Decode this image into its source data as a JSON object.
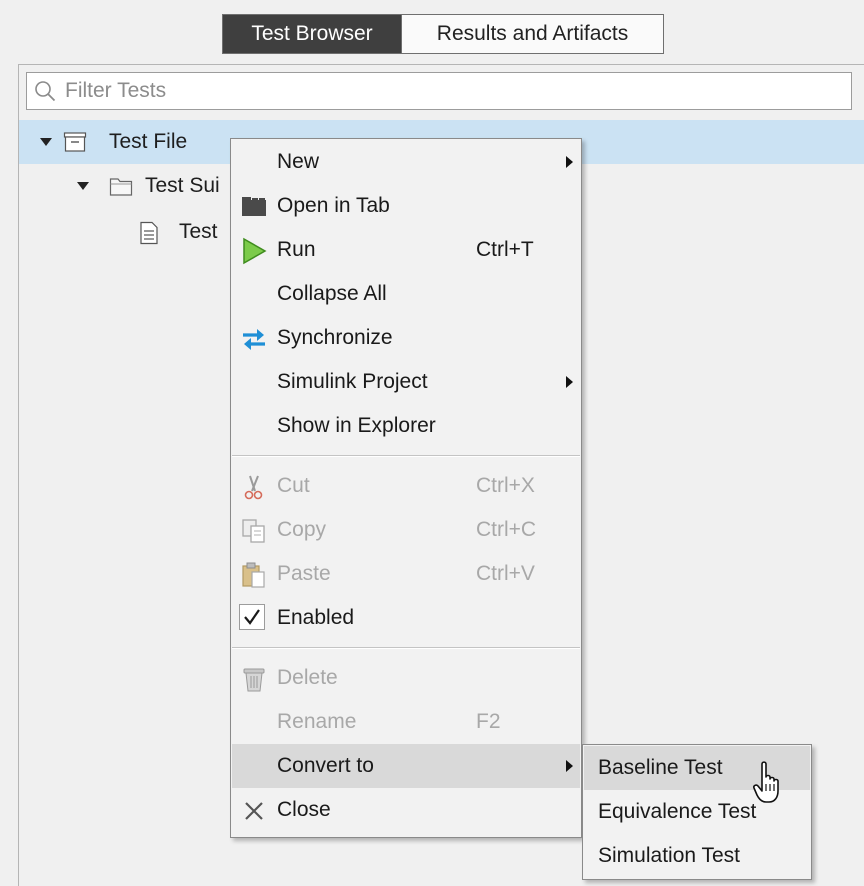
{
  "tabs": [
    {
      "label": "Test Browser",
      "active": true
    },
    {
      "label": "Results and Artifacts",
      "active": false
    }
  ],
  "filter": {
    "placeholder": "Filter Tests",
    "value": ""
  },
  "tree": {
    "file_label": "Test File",
    "suite_label": "Test Sui",
    "case_label": "Test"
  },
  "menu": {
    "new": {
      "label": "New"
    },
    "open_in_tab": {
      "label": "Open in Tab"
    },
    "run": {
      "label": "Run",
      "shortcut": "Ctrl+T"
    },
    "collapse_all": {
      "label": "Collapse All"
    },
    "synchronize": {
      "label": "Synchronize"
    },
    "simulink_project": {
      "label": "Simulink Project"
    },
    "show_in_explorer": {
      "label": "Show in Explorer"
    },
    "cut": {
      "label": "Cut",
      "shortcut": "Ctrl+X",
      "enabled": false
    },
    "copy": {
      "label": "Copy",
      "shortcut": "Ctrl+C",
      "enabled": false
    },
    "paste": {
      "label": "Paste",
      "shortcut": "Ctrl+V",
      "enabled": false
    },
    "enabled": {
      "label": "Enabled",
      "checked": true
    },
    "delete": {
      "label": "Delete",
      "enabled": false
    },
    "rename": {
      "label": "Rename",
      "shortcut": "F2",
      "enabled": false
    },
    "convert_to": {
      "label": "Convert to",
      "highlighted": true
    },
    "close": {
      "label": "Close"
    }
  },
  "submenu": {
    "baseline": {
      "label": "Baseline Test",
      "highlighted": true
    },
    "equivalence": {
      "label": "Equivalence Test"
    },
    "simulation": {
      "label": "Simulation Test"
    }
  },
  "icons": {
    "search": "search-icon",
    "test_file": "test-file-icon",
    "test_suite": "folder-icon",
    "test_case": "document-icon",
    "open_in_tab": "tab-icon",
    "run": "play-icon",
    "synchronize": "sync-icon",
    "cut": "scissors-icon",
    "copy": "copy-icon",
    "paste": "paste-icon",
    "enabled": "checkmark-icon",
    "delete": "trash-icon",
    "close": "close-icon",
    "cursor": "hand-pointer-icon"
  },
  "colors": {
    "selected_row": "#cbe2f3",
    "active_tab": "#3f3f3f",
    "menu_highlight": "#d9d9d9",
    "run_green": "#5cb82e",
    "sync_blue": "#1f8fd6"
  }
}
